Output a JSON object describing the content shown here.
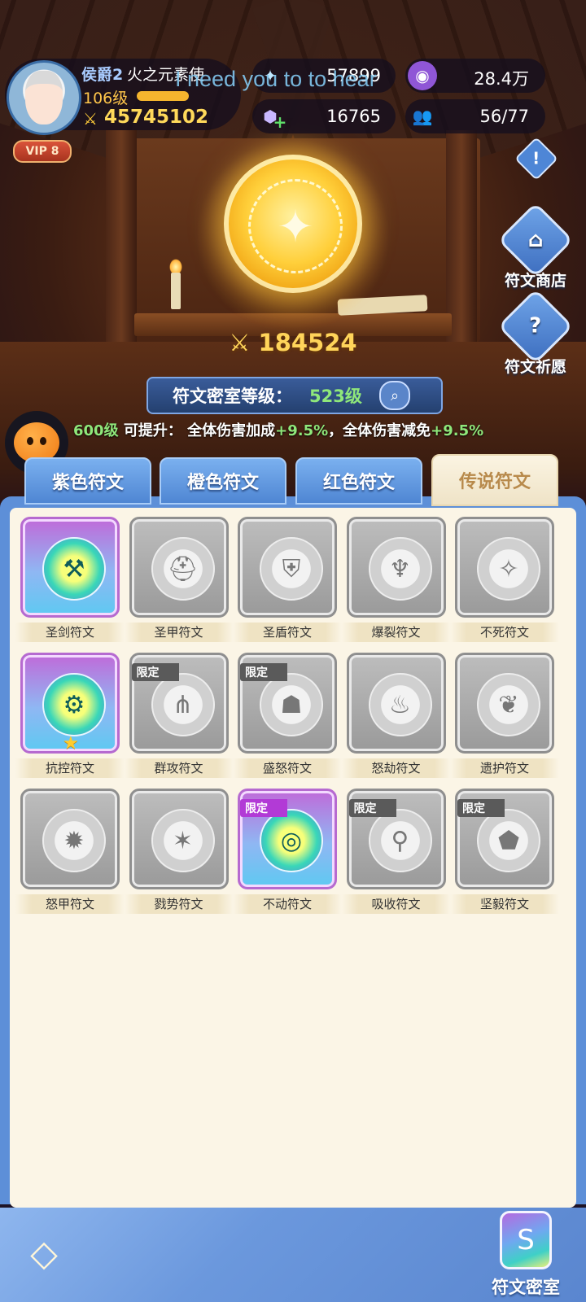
{
  "overlay_caption": "I need you to to hear",
  "player": {
    "title": "侯爵2",
    "name": "火之元素使",
    "level": "106级",
    "power": "45745102",
    "vip": "VIP 8"
  },
  "resources": {
    "crystal": "57899",
    "purple_coin": "28.4万",
    "cube": "16765",
    "members": "56/77"
  },
  "side_buttons": {
    "shop": "符文商店",
    "wish": "符文祈愿"
  },
  "scene": {
    "power": "184524",
    "level_label": "符文密室等级：",
    "level_value": "523级",
    "bonus": {
      "next_level": "600级",
      "text1": " 可提升： 全体伤害加成",
      "value1": "+9.5%",
      "text2": "，全体伤害减免",
      "value2": "+9.5%"
    }
  },
  "tabs": [
    "紫色符文",
    "橙色符文",
    "红色符文",
    "传说符文"
  ],
  "active_tab": "传说符文",
  "limit_tag": "限定",
  "runes": [
    {
      "name": "圣剑符文",
      "owned": true,
      "limited": false,
      "starred": false,
      "icon": "axe-icon"
    },
    {
      "name": "圣甲符文",
      "owned": false,
      "limited": false,
      "starred": false,
      "icon": "helmet-icon"
    },
    {
      "name": "圣盾符文",
      "owned": false,
      "limited": false,
      "starred": false,
      "icon": "shield-icon"
    },
    {
      "name": "爆裂符文",
      "owned": false,
      "limited": false,
      "starred": false,
      "icon": "dragon-icon"
    },
    {
      "name": "不死符文",
      "owned": false,
      "limited": false,
      "starred": false,
      "icon": "wings-icon"
    },
    {
      "name": "抗控符文",
      "owned": true,
      "limited": false,
      "starred": true,
      "icon": "gear-icon"
    },
    {
      "name": "群攻符文",
      "owned": false,
      "limited": true,
      "starred": false,
      "icon": "tridents-icon"
    },
    {
      "name": "盛怒符文",
      "owned": false,
      "limited": true,
      "starred": false,
      "icon": "demon-icon"
    },
    {
      "name": "怒劫符文",
      "owned": false,
      "limited": false,
      "starred": false,
      "icon": "flame-icon"
    },
    {
      "name": "遗护符文",
      "owned": false,
      "limited": false,
      "starred": false,
      "icon": "heart-icon"
    },
    {
      "name": "怒甲符文",
      "owned": false,
      "limited": false,
      "starred": false,
      "icon": "fire-icon"
    },
    {
      "name": "戮势符文",
      "owned": false,
      "limited": false,
      "starred": false,
      "icon": "burst-icon"
    },
    {
      "name": "不动符文",
      "owned": true,
      "limited": true,
      "starred": false,
      "icon": "target-icon",
      "limit_color": "pink"
    },
    {
      "name": "吸收符文",
      "owned": false,
      "limited": true,
      "starred": false,
      "icon": "cauldron-icon"
    },
    {
      "name": "坚毅符文",
      "owned": false,
      "limited": true,
      "starred": false,
      "icon": "badge-icon"
    }
  ],
  "bottom": {
    "room_label": "符文密室"
  }
}
